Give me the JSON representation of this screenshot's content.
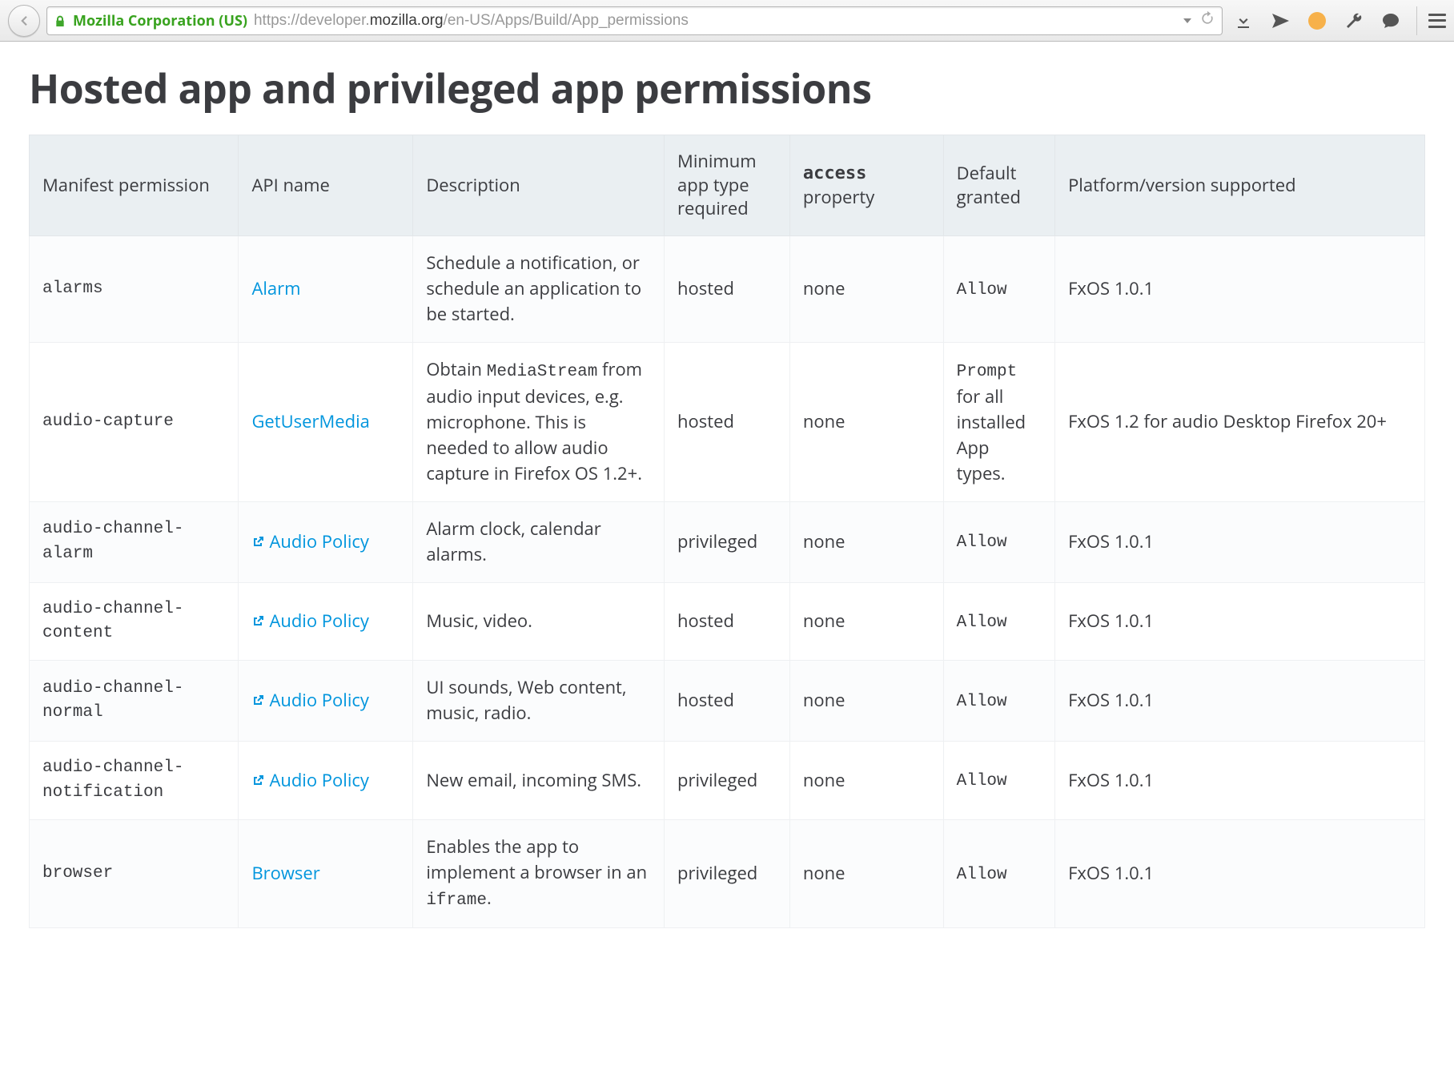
{
  "browser": {
    "identity": "Mozilla Corporation (US)",
    "url_prefix": "https://developer.",
    "url_host": "mozilla.org",
    "url_path": "/en-US/Apps/Build/App_permissions"
  },
  "page": {
    "title": "Hosted app and privileged app permissions"
  },
  "table": {
    "headers": {
      "manifest": "Manifest permission",
      "api": "API name",
      "desc": "Description",
      "min": "Minimum app type required",
      "access_code": "access",
      "access_rest": "property",
      "default": "Default granted",
      "platform": "Platform/version supported"
    },
    "rows": [
      {
        "perm": "alarms",
        "api": "Alarm",
        "api_ext": false,
        "desc_pre": "Schedule a notification, or schedule an application to be started.",
        "desc_code": "",
        "desc_post": "",
        "min": "hosted",
        "access": "none",
        "default_code": "Allow",
        "default_rest": "",
        "platform": "FxOS 1.0.1"
      },
      {
        "perm": "audio-capture",
        "api": "GetUserMedia",
        "api_ext": false,
        "desc_pre": "Obtain ",
        "desc_code": "MediaStream",
        "desc_post": " from audio input devices, e.g. microphone.  This is needed to allow audio capture in Firefox OS 1.2+.",
        "min": "hosted",
        "access": "none",
        "default_code": "Prompt",
        "default_rest": " for all installed App types.",
        "platform": "FxOS 1.2 for audio Desktop Firefox 20+"
      },
      {
        "perm": "audio-channel-alarm",
        "api": "Audio Policy",
        "api_ext": true,
        "desc_pre": "Alarm clock, calendar alarms.",
        "desc_code": "",
        "desc_post": "",
        "min": "privileged",
        "access": "none",
        "default_code": "Allow",
        "default_rest": "",
        "platform": "FxOS 1.0.1"
      },
      {
        "perm": "audio-channel-content",
        "api": "Audio Policy",
        "api_ext": true,
        "desc_pre": "Music, video.",
        "desc_code": "",
        "desc_post": "",
        "min": "hosted",
        "access": "none",
        "default_code": "Allow",
        "default_rest": "",
        "platform": "FxOS 1.0.1"
      },
      {
        "perm": "audio-channel-normal",
        "api": "Audio Policy",
        "api_ext": true,
        "desc_pre": "UI sounds, Web content, music, radio.",
        "desc_code": "",
        "desc_post": "",
        "min": "hosted",
        "access": "none",
        "default_code": "Allow",
        "default_rest": "",
        "platform": "FxOS 1.0.1"
      },
      {
        "perm": "audio-channel-notification",
        "api": "Audio Policy",
        "api_ext": true,
        "desc_pre": "New email, incoming SMS.",
        "desc_code": "",
        "desc_post": "",
        "min": "privileged",
        "access": "none",
        "default_code": "Allow",
        "default_rest": "",
        "platform": "FxOS 1.0.1"
      },
      {
        "perm": "browser",
        "api": "Browser",
        "api_ext": false,
        "desc_pre": "Enables the app to implement a browser in an ",
        "desc_code": "iframe",
        "desc_post": ".",
        "min": "privileged",
        "access": "none",
        "default_code": "Allow",
        "default_rest": "",
        "platform": "FxOS 1.0.1"
      }
    ]
  }
}
